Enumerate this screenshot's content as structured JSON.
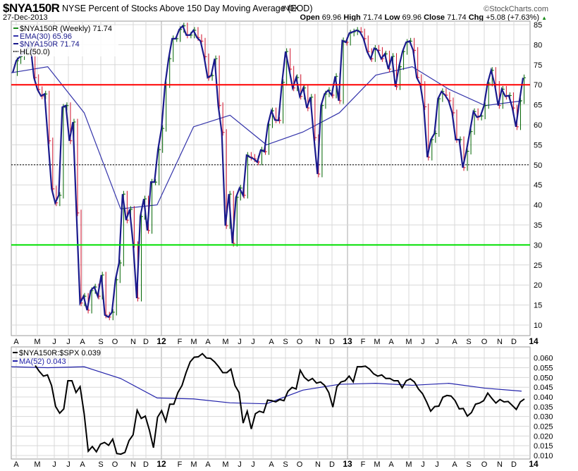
{
  "header": {
    "symbol": "$NYA150R",
    "description": "NYSE Percent of Stocks Above 150 Day Moving Average (EOD)",
    "exchange": "INDX",
    "brand": "©StockCharts.com",
    "date": "27-Dec-2013",
    "open_label": "Open",
    "open": "69.96",
    "high_label": "High",
    "high": "71.74",
    "low_label": "Low",
    "low": "69.96",
    "close_label": "Close",
    "close": "71.74",
    "chg_label": "Chg",
    "chg": "+5.08 (+7.63%)",
    "up_arrow": "▲"
  },
  "colors": {
    "price": "#1a1a8c",
    "ema": "#3333aa",
    "up_bar": "#006400",
    "down_bar": "#d0102a",
    "line70": "#ff0000",
    "line30": "#00e000",
    "ratio": "#000000",
    "ma52": "#2222aa",
    "grid": "#d8d8d8"
  },
  "chart_data": [
    {
      "type": "line",
      "title": "$NYA150R (Weekly) 71.74",
      "legend": [
        "$NYA150R (Weekly) 71.74",
        "EMA(30) 65.96",
        "$NYA150R 71.74",
        "HL(50.0)"
      ],
      "legend_placement": "top-left",
      "ylim": [
        7,
        86
      ],
      "yticks": [
        10,
        15,
        20,
        25,
        30,
        35,
        40,
        45,
        50,
        55,
        60,
        65,
        70,
        75,
        80,
        85
      ],
      "xticks": [
        "A",
        "M",
        "J",
        "J",
        "A",
        "S",
        "O",
        "N",
        "D",
        "12",
        "F",
        "M",
        "A",
        "M",
        "J",
        "J",
        "A",
        "S",
        "O",
        "N",
        "D",
        "13",
        "F",
        "M",
        "A",
        "M",
        "J",
        "J",
        "A",
        "S",
        "O",
        "N",
        "D",
        "14"
      ],
      "hlines": {
        "upper": 70,
        "lower": 30,
        "mid": 50
      },
      "close": [
        73,
        76,
        77,
        78,
        79,
        80,
        71.8,
        68.8,
        67.2,
        67.7,
        56,
        44,
        40.5,
        42.4,
        64.4,
        64.8,
        56,
        60.7,
        38,
        15.5,
        17.2,
        13.7,
        18.6,
        19.5,
        17.2,
        22.5,
        12.5,
        12,
        13.2,
        21.3,
        25.5,
        42.7,
        36.2,
        38.9,
        30.1,
        16.7,
        37.1,
        41.5,
        33.6,
        45.7,
        45.7,
        53.8,
        59.1,
        70,
        76.5,
        81.5,
        81.5,
        83.8,
        84.7,
        82.4,
        82.4,
        83.6,
        81.8,
        80.9,
        77,
        71.8,
        72.3,
        76.5,
        64.8,
        58.1,
        34.8,
        42.7,
        30.4,
        41.9,
        44.2,
        42.4,
        52.4,
        51.9,
        51.5,
        50.7,
        53.7,
        53.3,
        60,
        63.5,
        61.2,
        61.1,
        70.6,
        78.3,
        73.9,
        69.2,
        71.8,
        67.1,
        69.2,
        64.2,
        66.9,
        56.8,
        47.7,
        64.8,
        67.7,
        68.6,
        67.4,
        72.1,
        66,
        81,
        80.6,
        82.9,
        83.2,
        83.6,
        83.2,
        81.5,
        78.3,
        76.5,
        79.1,
        78.6,
        76.5,
        77.7,
        73.9,
        77.1,
        69.5,
        74.5,
        78.3,
        80.6,
        80.9,
        78.6,
        71.8,
        70.1,
        64.5,
        51.9,
        56.3,
        57.8,
        66.5,
        68.3,
        67.4,
        66,
        63,
        56.3,
        56.3,
        49.3,
        53.4,
        58.3,
        63.3,
        61.9,
        62.2,
        64.8,
        70.4,
        73.6,
        70.1,
        64.8,
        68.9,
        67.1,
        67.3,
        64.2,
        59.5,
        66,
        71.74
      ],
      "ema30": [
        73,
        74.5,
        63,
        39,
        40,
        59.5,
        62.4,
        55,
        58.2,
        63,
        72.4,
        74.5,
        68.9,
        64.8,
        65.96
      ]
    },
    {
      "type": "line",
      "title": "$NYA150R:$SPX 0.039",
      "legend": [
        "$NYA150R:$SPX 0.039",
        "MA(52) 0.043"
      ],
      "legend_placement": "top-left",
      "ylim": [
        0.0075,
        0.0635
      ],
      "yticks": [
        "0.010",
        "0.015",
        "0.020",
        "0.025",
        "0.030",
        "0.035",
        "0.040",
        "0.045",
        "0.050",
        "0.055",
        "0.060"
      ],
      "ratio": [
        0.0561,
        0.0531,
        0.0507,
        0.0513,
        0.0459,
        0.0351,
        0.0317,
        0.0339,
        0.0483,
        0.0483,
        0.0423,
        0.0453,
        0.0314,
        0.0122,
        0.0146,
        0.0119,
        0.0158,
        0.0167,
        0.0152,
        0.0184,
        0.011,
        0.0107,
        0.0116,
        0.0176,
        0.0206,
        0.0332,
        0.029,
        0.0302,
        0.023,
        0.014,
        0.0296,
        0.033,
        0.0275,
        0.0363,
        0.0363,
        0.0423,
        0.0459,
        0.0525,
        0.058,
        0.0604,
        0.0606,
        0.0622,
        0.06,
        0.0598,
        0.058,
        0.0555,
        0.0525,
        0.0525,
        0.0543,
        0.0459,
        0.0423,
        0.0266,
        0.0327,
        0.0236,
        0.0314,
        0.0327,
        0.032,
        0.0384,
        0.0381,
        0.0375,
        0.0387,
        0.0381,
        0.0429,
        0.0449,
        0.0441,
        0.0537,
        0.0501,
        0.0483,
        0.0495,
        0.0471,
        0.0477,
        0.0459,
        0.0423,
        0.0348,
        0.0453,
        0.0477,
        0.0483,
        0.0507,
        0.0477,
        0.0555,
        0.0555,
        0.0558,
        0.0543,
        0.0519,
        0.0507,
        0.0513,
        0.0495,
        0.0495,
        0.0483,
        0.0483,
        0.0447,
        0.0483,
        0.0493,
        0.0477,
        0.0441,
        0.0417,
        0.0375,
        0.0327,
        0.0351,
        0.0353,
        0.0399,
        0.0408,
        0.0405,
        0.0381,
        0.0339,
        0.0341,
        0.0302,
        0.032,
        0.0363,
        0.0369,
        0.0381,
        0.042,
        0.0393,
        0.0369,
        0.0387,
        0.0375,
        0.0377,
        0.0357,
        0.0336,
        0.0375,
        0.039
      ],
      "ma52": [
        0.0555,
        0.055,
        0.0555,
        0.0495,
        0.0395,
        0.039,
        0.037,
        0.0365,
        0.0435,
        0.0465,
        0.047,
        0.046,
        0.047,
        0.0445,
        0.043
      ]
    }
  ]
}
